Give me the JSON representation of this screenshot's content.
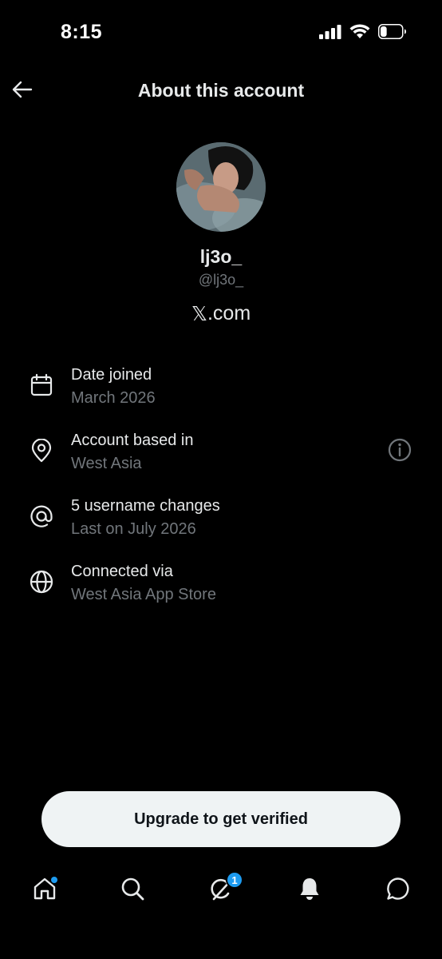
{
  "status_bar": {
    "time": "8:15",
    "icons": [
      "signal-icon",
      "wifi-icon",
      "battery-icon"
    ],
    "battery_level": 0.3
  },
  "header": {
    "back_icon": "arrow-left-icon",
    "title": "About this account"
  },
  "profile": {
    "display_name": "lj3o_",
    "handle": "@lj3o_",
    "site_logo": "𝕏",
    "site_suffix": ".com"
  },
  "info": [
    {
      "icon": "calendar-icon",
      "label": "Date joined",
      "value": "March 2026"
    },
    {
      "icon": "location-pin-icon",
      "label": "Account based in",
      "value": "West Asia",
      "action_icon": "info-icon"
    },
    {
      "icon": "at-sign-icon",
      "label": "5 username changes",
      "value": "Last on July 2026"
    },
    {
      "icon": "globe-icon",
      "label": "Connected via",
      "value": "West Asia App Store"
    }
  ],
  "upgrade_button": {
    "label": "Upgrade to get verified"
  },
  "tab_bar": {
    "items": [
      {
        "icon": "home-icon",
        "has_dot": true
      },
      {
        "icon": "search-icon"
      },
      {
        "icon": "grok-icon",
        "badge": "1"
      },
      {
        "icon": "notifications-bell-icon"
      },
      {
        "icon": "messages-icon"
      }
    ]
  },
  "colors": {
    "background": "#000000",
    "primary_text": "#e7e9ea",
    "secondary_text": "#71767b",
    "accent": "#1d9bf0",
    "button_bg": "#eff3f4"
  }
}
